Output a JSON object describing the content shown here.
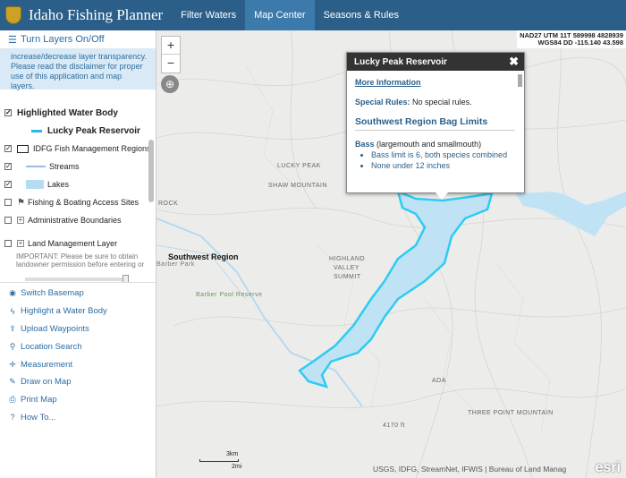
{
  "header": {
    "title": "Idaho Fishing Planner",
    "nav": [
      {
        "label": "Filter Waters",
        "active": false
      },
      {
        "label": "Map Center",
        "active": true
      },
      {
        "label": "Seasons & Rules",
        "active": false
      }
    ]
  },
  "sidebar": {
    "turn_layers_label": "Turn Layers On/Off",
    "notice": "increase/decrease layer transparency. Please read the disclaimer for proper use of this application and map layers.",
    "layers": [
      {
        "label": "Highlighted Water Body",
        "checked": true
      },
      {
        "label": "Lucky Peak Reservoir"
      },
      {
        "label": "IDFG Fish Management Regions",
        "checked": true
      },
      {
        "label": "Streams",
        "checked": true
      },
      {
        "label": "Lakes",
        "checked": true
      },
      {
        "label": "Fishing & Boating Access Sites",
        "checked": false
      },
      {
        "label": "Administrative Boundaries",
        "checked": false
      },
      {
        "label": "Land Management Layer",
        "checked": false
      }
    ],
    "land_note": "IMPORTANT: Please be sure to obtain landowner permission before entering or",
    "actions": [
      {
        "label": "Switch Basemap",
        "icon": "globe-icon"
      },
      {
        "label": "Highlight a Water Body",
        "icon": "lightning-icon"
      },
      {
        "label": "Upload Waypoints",
        "icon": "upload-icon"
      },
      {
        "label": "Location Search",
        "icon": "search-icon"
      },
      {
        "label": "Measurement",
        "icon": "crosshair-icon"
      },
      {
        "label": "Draw on Map",
        "icon": "pencil-icon"
      },
      {
        "label": "Print Map",
        "icon": "print-icon"
      },
      {
        "label": "How To...",
        "icon": "question-icon"
      }
    ]
  },
  "map": {
    "coords_line1": "NAD27 UTM 11T 589998 4828939",
    "coords_line2": "WGS84 DD -115.140 43.598",
    "zoom_in": "+",
    "zoom_out": "−",
    "labels": {
      "lucky_peak": "LUCKY PEAK",
      "shaw_mountain": "SHAW MOUNTAIN",
      "rock": "ROCK",
      "highland": "HIGHLAND",
      "valley": "VALLEY",
      "summit": "SUMMIT",
      "three_point": "THREE POINT MOUNTAIN",
      "elevation": "4170 ft",
      "region": "Southwest Region",
      "barber_park": "Barber Park",
      "barber_pool": "Barber Pool Reserve",
      "ada": "ADA"
    },
    "scale_top": "3km",
    "scale_bottom": "2mi",
    "attribution": "USGS, IDFG, StreamNet, IFWIS | Bureau of Land Manag",
    "logo": "esri",
    "water_color": "#bfe3f5",
    "highlight_color": "#2ecbf2"
  },
  "popup": {
    "title": "Lucky Peak Reservoir",
    "more_info": "More Information",
    "special_label": "Special Rules:",
    "special_value": "No special rules.",
    "bag_title": "Southwest Region Bag Limits",
    "species_name": "Bass",
    "species_note": "(largemouth and smallmouth)",
    "rules": [
      "Bass limit is 6, both species combined",
      "None under 12 inches"
    ]
  }
}
